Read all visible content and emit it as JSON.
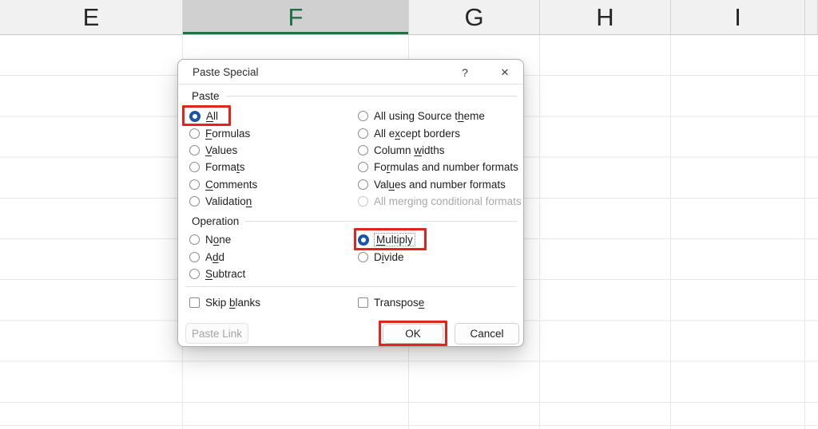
{
  "spreadsheet": {
    "columns": [
      {
        "label": "E",
        "selected": false
      },
      {
        "label": "F",
        "selected": true
      },
      {
        "label": "G",
        "selected": false
      },
      {
        "label": "H",
        "selected": false
      },
      {
        "label": "I",
        "selected": false
      }
    ],
    "selected_column": "F",
    "selected_header_green": "#1e7145"
  },
  "dialog": {
    "title": "Paste Special",
    "help_label": "?",
    "close_label": "×",
    "annotation_color": "#e1251c",
    "accent_blue": "#1a56a5",
    "paste_group": {
      "label": "Paste",
      "left": [
        {
          "pre": "",
          "key": "A",
          "post": "ll",
          "selected": true
        },
        {
          "pre": "",
          "key": "F",
          "post": "ormulas",
          "selected": false
        },
        {
          "pre": "",
          "key": "V",
          "post": "alues",
          "selected": false
        },
        {
          "pre": "Forma",
          "key": "t",
          "post": "s",
          "selected": false
        },
        {
          "pre": "",
          "key": "C",
          "post": "omments",
          "selected": false
        },
        {
          "pre": "Validatio",
          "key": "n",
          "post": "",
          "selected": false
        }
      ],
      "right": [
        {
          "pre": "All using Source t",
          "key": "h",
          "post": "eme",
          "selected": false
        },
        {
          "pre": "All e",
          "key": "x",
          "post": "cept borders",
          "selected": false
        },
        {
          "pre": "Column ",
          "key": "w",
          "post": "idths",
          "selected": false
        },
        {
          "pre": "Fo",
          "key": "r",
          "post": "mulas and number formats",
          "selected": false
        },
        {
          "pre": "Val",
          "key": "u",
          "post": "es and number formats",
          "selected": false
        },
        {
          "pre": "All merging conditional formats",
          "key": "",
          "post": "",
          "selected": false,
          "disabled": true
        }
      ]
    },
    "operation_group": {
      "label": "Operation",
      "left": [
        {
          "pre": "N",
          "key": "o",
          "post": "ne",
          "selected": false
        },
        {
          "pre": "A",
          "key": "d",
          "post": "d",
          "selected": false
        },
        {
          "pre": "",
          "key": "S",
          "post": "ubtract",
          "selected": false
        }
      ],
      "right": [
        {
          "pre": "",
          "key": "M",
          "post": "ultiply",
          "selected": true,
          "focused": true
        },
        {
          "pre": "D",
          "key": "i",
          "post": "vide",
          "selected": false
        }
      ]
    },
    "checkboxes": {
      "skip_blanks": {
        "pre": "Skip ",
        "key": "b",
        "post": "lanks",
        "checked": false
      },
      "transpose": {
        "pre": "Transpos",
        "key": "e",
        "post": "",
        "checked": false
      }
    },
    "buttons": {
      "paste_link": "Paste Link",
      "ok": "OK",
      "cancel": "Cancel"
    }
  }
}
